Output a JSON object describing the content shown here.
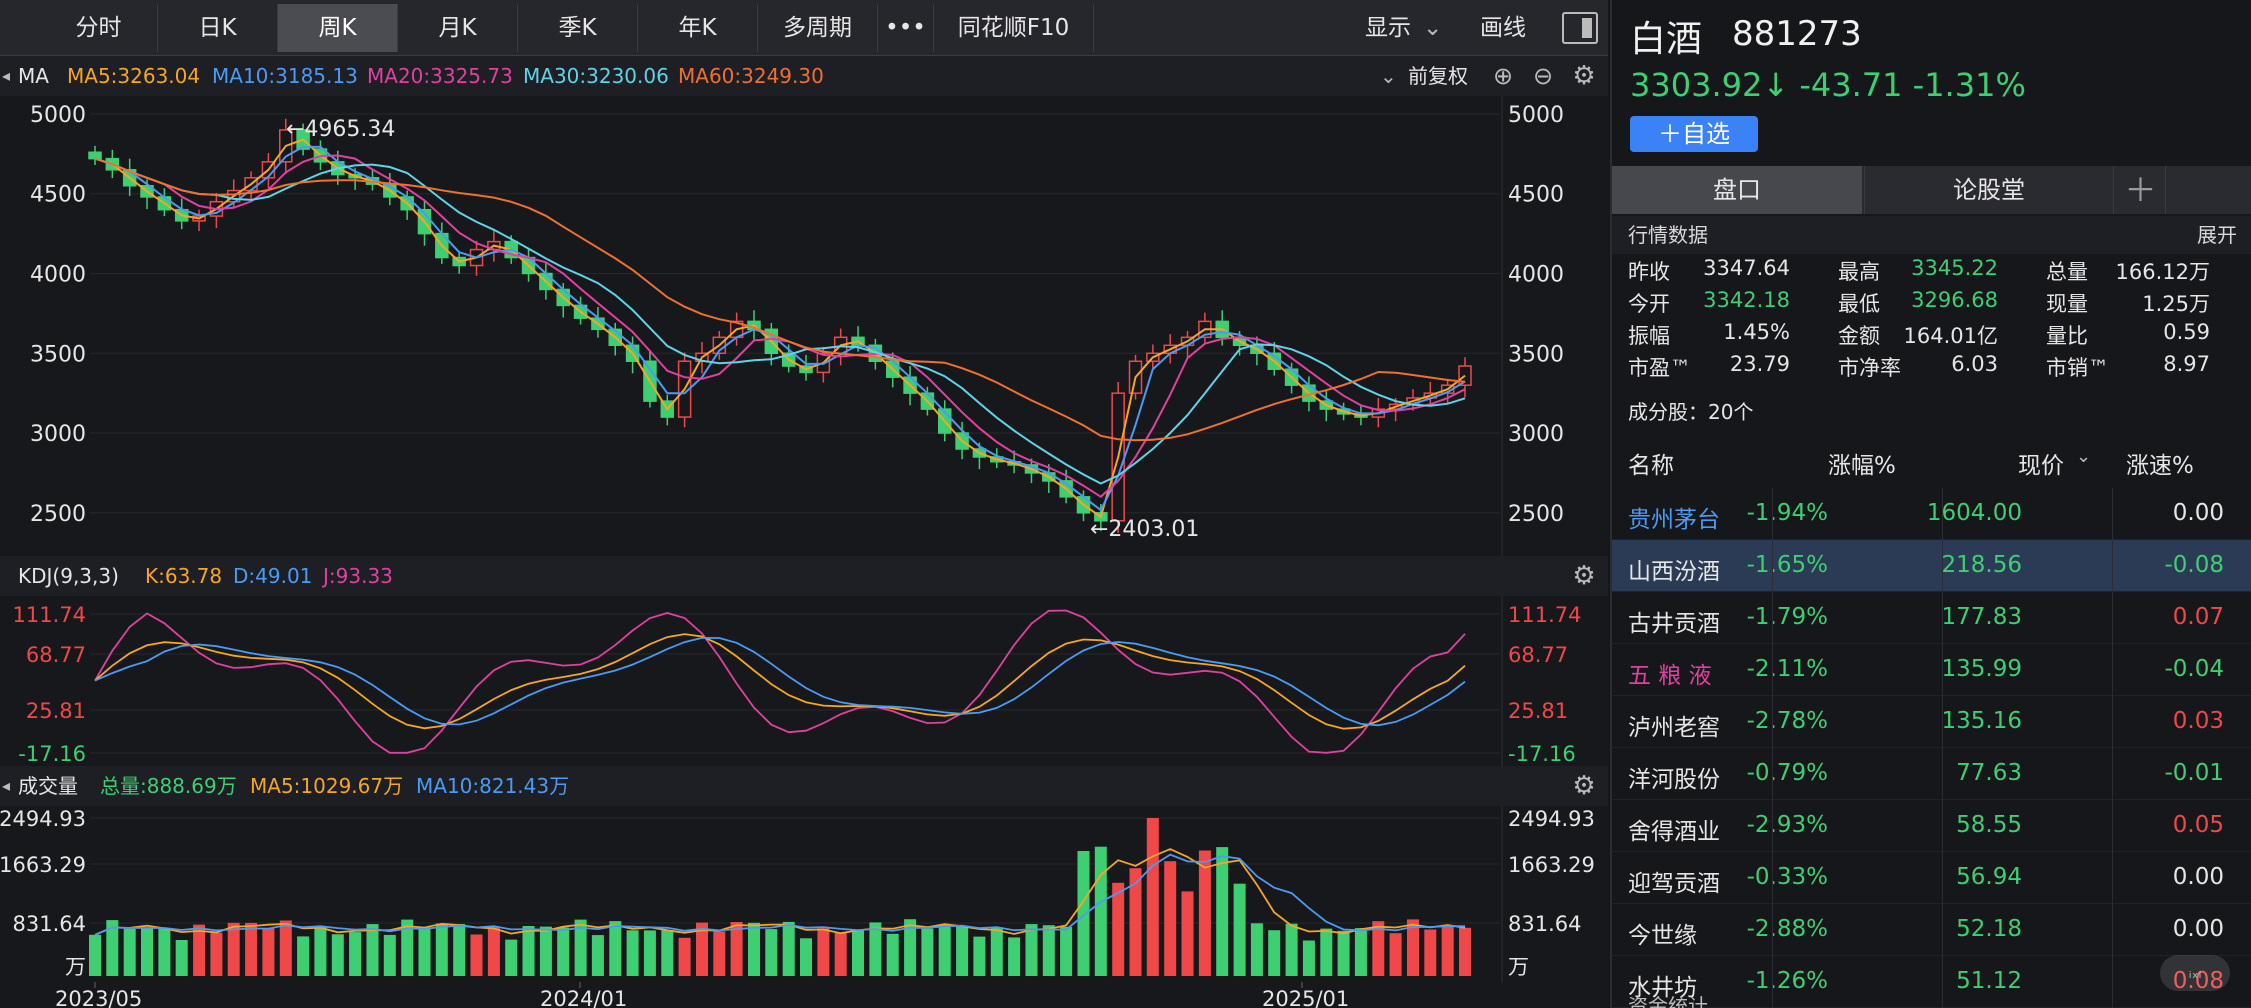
{
  "tabs": [
    "分时",
    "日K",
    "周K",
    "月K",
    "季K",
    "年K",
    "多周期",
    "•••",
    "同花顺F10"
  ],
  "active_tab": "周K",
  "toolbar": {
    "display": "显示",
    "draw": "画线"
  },
  "ma_header": {
    "title": "MA",
    "items": [
      {
        "label": "MA5:3263.04",
        "color": "#f5a623"
      },
      {
        "label": "MA10:3185.13",
        "color": "#4a9bf5"
      },
      {
        "label": "MA20:3325.73",
        "color": "#e040a0"
      },
      {
        "label": "MA30:3230.06",
        "color": "#5fd3e8"
      },
      {
        "label": "MA60:3249.30",
        "color": "#f07030"
      }
    ],
    "adjust": "前复权"
  },
  "kdj_header": {
    "title": "KDJ(9,3,3)",
    "items": [
      {
        "label": "K:63.78",
        "color": "#f5a623"
      },
      {
        "label": "D:49.01",
        "color": "#4a9bf5"
      },
      {
        "label": "J:93.33",
        "color": "#e040a0"
      }
    ]
  },
  "vol_header": {
    "title": "成交量",
    "items": [
      {
        "label": "总量:888.69万",
        "color": "#3ecf72"
      },
      {
        "label": "MA5:1029.67万",
        "color": "#f5a623"
      },
      {
        "label": "MA10:821.43万",
        "color": "#4a9bf5"
      }
    ]
  },
  "price_axis": [
    "5000",
    "4500",
    "4000",
    "3500",
    "3000",
    "2500"
  ],
  "kdj_axis": [
    "111.74",
    "68.77",
    "25.81",
    "-17.16"
  ],
  "vol_axis": [
    "2494.93",
    "1663.29",
    "831.64",
    "万"
  ],
  "x_labels": [
    "2023/05",
    "2024/01",
    "2025/01"
  ],
  "annotations": {
    "high": "←4965.34",
    "low": "←2403.01"
  },
  "chart_data": {
    "type": "candlestick",
    "period": "weekly",
    "ylim": [
      2400,
      5050
    ],
    "high": 4965.34,
    "low": 2403.01,
    "close_path": [
      4720,
      4650,
      4550,
      4480,
      4400,
      4330,
      4360,
      4450,
      4520,
      4600,
      4700,
      4900,
      4780,
      4700,
      4620,
      4600,
      4560,
      4480,
      4400,
      4250,
      4100,
      4050,
      4150,
      4200,
      4100,
      4000,
      3900,
      3800,
      3720,
      3650,
      3550,
      3450,
      3200,
      3100,
      3450,
      3500,
      3600,
      3700,
      3650,
      3500,
      3420,
      3380,
      3500,
      3600,
      3550,
      3450,
      3350,
      3250,
      3150,
      3000,
      2900,
      2850,
      2820,
      2800,
      2750,
      2700,
      2600,
      2500,
      2450,
      3250,
      3450,
      3500,
      3550,
      3600,
      3700,
      3600,
      3550,
      3500,
      3400,
      3300,
      3200,
      3150,
      3120,
      3100,
      3150,
      3180,
      3220,
      3250,
      3300,
      3420
    ],
    "kdj": {
      "K_last": 63.78,
      "D_last": 49.01,
      "J_last": 93.33,
      "ylim": [
        -17.16,
        111.74
      ]
    },
    "volume_max": 2494.93
  },
  "right": {
    "name": "白酒",
    "code": "881273",
    "price_line": "3303.92↓ -43.71 -1.31%",
    "fav_button": "＋自选",
    "tabs": [
      "盘口",
      "论股堂",
      "＋"
    ],
    "quote_title": "行情数据",
    "expand": "展开",
    "quote": [
      [
        "昨收",
        "3347.64",
        "最高",
        "3345.22",
        "总量",
        "166.12万"
      ],
      [
        "今开",
        "3342.18",
        "最低",
        "3296.68",
        "现量",
        "1.25万"
      ],
      [
        "振幅",
        "1.45%",
        "金额",
        "164.01亿",
        "量比",
        "0.59"
      ],
      [
        "市盈™",
        "23.79",
        "市净率",
        "6.03",
        "市销™",
        "8.97"
      ]
    ],
    "constituents_label": "成分股：20个",
    "list_headers": [
      "名称",
      "涨幅%",
      "现价",
      "涨速%"
    ],
    "rows": [
      {
        "name": "贵州茅台",
        "chg": "-1.94%",
        "price": "1604.00",
        "speed": "0.00",
        "name_color": "#4a9bf5",
        "speed_color": "#e6e6e6"
      },
      {
        "name": "山西汾酒",
        "chg": "-1.65%",
        "price": "218.56",
        "speed": "-0.08",
        "name_color": "#e6e6e6",
        "speed_color": "#3ecf72",
        "selected": true
      },
      {
        "name": "古井贡酒",
        "chg": "-1.79%",
        "price": "177.83",
        "speed": "0.07",
        "name_color": "#e6e6e6",
        "speed_color": "#f04848"
      },
      {
        "name": "五 粮 液",
        "chg": "-2.11%",
        "price": "135.99",
        "speed": "-0.04",
        "name_color": "#e040a0",
        "speed_color": "#3ecf72"
      },
      {
        "name": "泸州老窖",
        "chg": "-2.78%",
        "price": "135.16",
        "speed": "0.03",
        "name_color": "#e6e6e6",
        "speed_color": "#f04848"
      },
      {
        "name": "洋河股份",
        "chg": "-0.79%",
        "price": "77.63",
        "speed": "-0.01",
        "name_color": "#e6e6e6",
        "speed_color": "#3ecf72"
      },
      {
        "name": "舍得酒业",
        "chg": "-2.93%",
        "price": "58.55",
        "speed": "0.05",
        "name_color": "#e6e6e6",
        "speed_color": "#f04848"
      },
      {
        "name": "迎驾贡酒",
        "chg": "-0.33%",
        "price": "56.94",
        "speed": "0.00",
        "name_color": "#e6e6e6",
        "speed_color": "#e6e6e6"
      },
      {
        "name": "今世缘",
        "chg": "-2.88%",
        "price": "52.18",
        "speed": "0.00",
        "name_color": "#e6e6e6",
        "speed_color": "#e6e6e6"
      },
      {
        "name": "水井坊",
        "chg": "-1.26%",
        "price": "51.12",
        "speed": "0.08",
        "name_color": "#e6e6e6",
        "speed_color": "#f04848"
      }
    ],
    "bottom_cut": "资金统计"
  },
  "colors": {
    "up": "#f04848",
    "down": "#3ecf72",
    "accent": "#3a82f6"
  }
}
